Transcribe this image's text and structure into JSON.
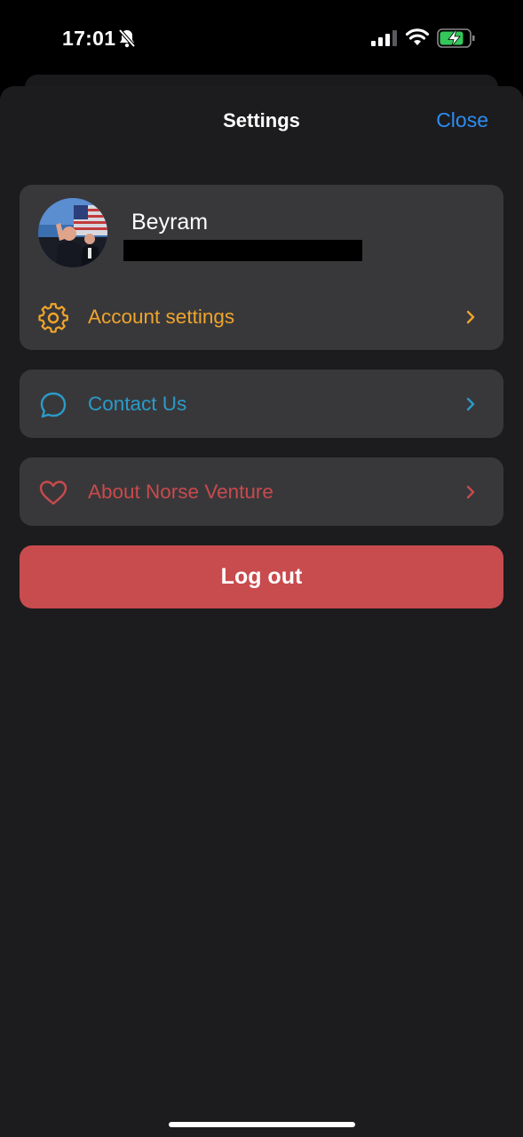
{
  "status_bar": {
    "time": "17:01",
    "icons": [
      "bell-slash-icon",
      "cellular-signal-icon",
      "wifi-icon",
      "battery-charging-icon"
    ]
  },
  "header": {
    "title": "Settings",
    "close_label": "Close"
  },
  "profile": {
    "name": "Beyram"
  },
  "menu": {
    "account": {
      "label": "Account settings",
      "icon": "gear-icon",
      "color": "#f0a42a"
    },
    "contact": {
      "label": "Contact Us",
      "icon": "chat-bubble-icon",
      "color": "#2a9bc8"
    },
    "about": {
      "label": "About Norse Venture",
      "icon": "heart-icon",
      "color": "#c94a4c"
    }
  },
  "logout_label": "Log out",
  "colors": {
    "accent_blue": "#2d8df0",
    "logout_red": "#c84b4e",
    "card_bg": "#38383b",
    "sheet_bg": "#1c1c1e"
  }
}
